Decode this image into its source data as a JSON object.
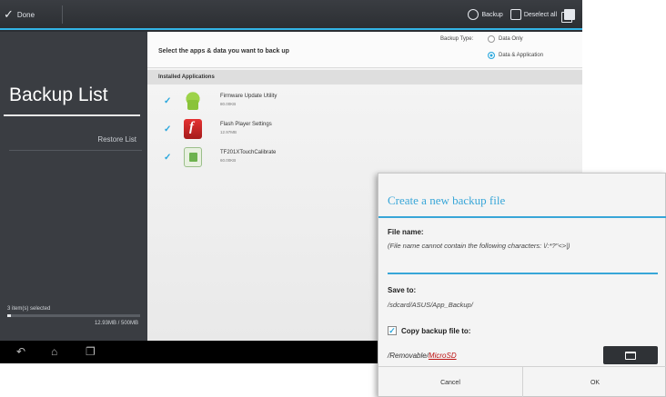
{
  "topbar": {
    "done_label": "Done",
    "actions": [
      {
        "label": "Backup",
        "icon": "backup-clock-icon"
      },
      {
        "label": "Deselect all",
        "icon": "deselect-all-icon"
      },
      {
        "label": "",
        "icon": "copy-icon"
      }
    ]
  },
  "sidebar": {
    "title": "Backup List",
    "restore_label": "Restore List",
    "selected_text": "3 item(s) selected",
    "size_text": "12.93MB / 500MB",
    "progress": 0.03
  },
  "main": {
    "prompt": "Select the apps & data you want to back up",
    "backup_type_label": "Backup Type:",
    "options": [
      {
        "label": "Data Only",
        "selected": false
      },
      {
        "label": "Data & Application",
        "selected": true
      }
    ],
    "installed_header": "Installed Applications",
    "apps": [
      {
        "name": "Firmware Update Utility",
        "size": "80.00KB",
        "icon": "android-icon",
        "checked": true
      },
      {
        "name": "Flash Player Settings",
        "size": "12.97MB",
        "icon": "flash-icon",
        "checked": true
      },
      {
        "name": "TF201XTouchCalibrate",
        "size": "60.00KB",
        "icon": "calibrate-icon",
        "checked": true
      }
    ]
  },
  "dialog": {
    "title": "Create a new backup file",
    "file_name_label": "File name:",
    "file_name_hint": "(File name cannot contain the following characters: \\/:*?\"<>|)",
    "save_to_label": "Save to:",
    "save_path": "/sdcard/ASUS/App_Backup/",
    "copy_label": "Copy backup file to:",
    "copy_checked": true,
    "dest_prefix": "/Removable/",
    "dest_device": "MicroSD",
    "cancel_label": "Cancel",
    "ok_label": "OK"
  },
  "colors": {
    "accent": "#38a6d8",
    "sidebar": "#3a3d42",
    "topbar": "#2c2f33"
  }
}
